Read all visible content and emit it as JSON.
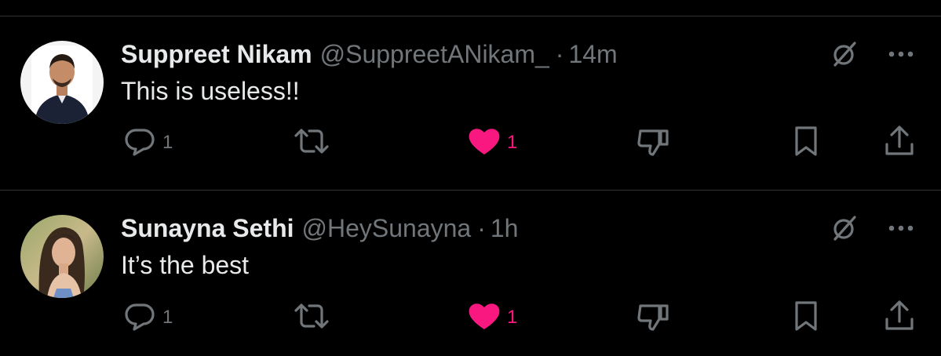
{
  "colors": {
    "background": "#000000",
    "text_primary": "#e7e9ea",
    "text_secondary": "#71767b",
    "divider": "#2f3336",
    "like_pink": "#f91880"
  },
  "replies": [
    {
      "display_name": "Suppreet Nikam",
      "handle": "@SuppreetANikam_",
      "separator": "·",
      "time": "14m",
      "text": "This is useless!!",
      "icons": [
        "grok-icon",
        "more-icon",
        "reply-icon",
        "repost-icon",
        "like-icon",
        "dislike-icon",
        "bookmark-icon",
        "share-icon"
      ],
      "reply_count": "1",
      "like_count": "1",
      "liked": true
    },
    {
      "display_name": "Sunayna Sethi",
      "handle": "@HeySunayna",
      "separator": "·",
      "time": "1h",
      "text": "It’s the best",
      "icons": [
        "grok-icon",
        "more-icon",
        "reply-icon",
        "repost-icon",
        "like-icon",
        "dislike-icon",
        "bookmark-icon",
        "share-icon"
      ],
      "reply_count": "1",
      "like_count": "1",
      "liked": true
    }
  ]
}
